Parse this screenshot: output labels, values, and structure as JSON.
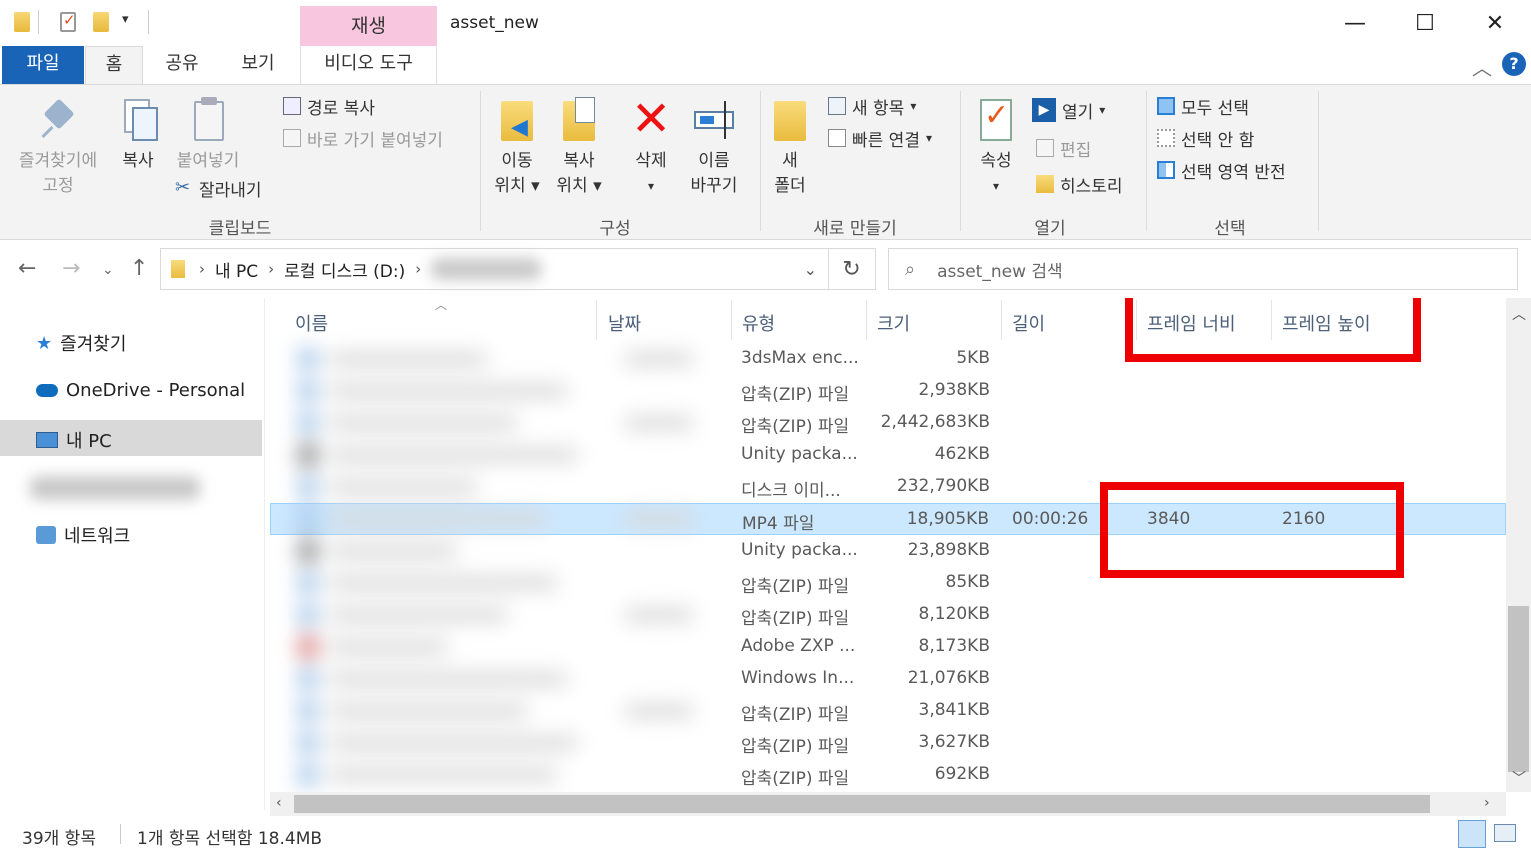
{
  "window": {
    "title": "asset_new",
    "context_tab_group": "재생",
    "controls": {
      "minimize": "—",
      "maximize": "☐",
      "close": "✕"
    }
  },
  "ribbon_tabs": {
    "file": "파일",
    "home": "홈",
    "share": "공유",
    "view": "보기",
    "video_tools": "비디오 도구"
  },
  "ribbon": {
    "clipboard": {
      "label": "클립보드",
      "pin": [
        "즐겨찾기에",
        "고정"
      ],
      "copy": "복사",
      "paste": "붙여넣기",
      "copy_path": "경로 복사",
      "paste_shortcut": "바로 가기 붙여넣기",
      "cut": "잘라내기"
    },
    "organize": {
      "label": "구성",
      "move_to": [
        "이동",
        "위치"
      ],
      "copy_to": [
        "복사",
        "위치"
      ],
      "delete": "삭제",
      "rename": [
        "이름",
        "바꾸기"
      ]
    },
    "new": {
      "label": "새로 만들기",
      "new_folder": [
        "새",
        "폴더"
      ],
      "new_item": "새 항목",
      "easy_access": "빠른 연결"
    },
    "open": {
      "label": "열기",
      "properties": "속성",
      "open": "열기",
      "edit": "편집",
      "history": "히스토리"
    },
    "select": {
      "label": "선택",
      "select_all": "모두 선택",
      "select_none": "선택 안 함",
      "invert": "선택 영역 반전"
    }
  },
  "address": {
    "crumbs": [
      "내 PC",
      "로컬 디스크 (D:)"
    ],
    "search_placeholder": "asset_new 검색"
  },
  "nav_pane": {
    "quick_access": "즐겨찾기",
    "onedrive": "OneDrive - Personal",
    "this_pc": "내 PC",
    "network": "네트워크"
  },
  "columns": {
    "name": "이름",
    "date": "날짜",
    "type": "유형",
    "size": "크기",
    "length": "길이",
    "frame_width": "프레임 너비",
    "frame_height": "프레임 높이"
  },
  "files": [
    {
      "type": "3dsMax enc...",
      "size": "5KB",
      "length": "",
      "width": "",
      "height": ""
    },
    {
      "type": "압축(ZIP) 파일",
      "size": "2,938KB",
      "length": "",
      "width": "",
      "height": ""
    },
    {
      "type": "압축(ZIP) 파일",
      "size": "2,442,683KB",
      "length": "",
      "width": "",
      "height": ""
    },
    {
      "type": "Unity packa...",
      "size": "462KB",
      "length": "",
      "width": "",
      "height": ""
    },
    {
      "type": "디스크 이미...",
      "size": "232,790KB",
      "length": "",
      "width": "",
      "height": ""
    },
    {
      "type": "MP4 파일",
      "size": "18,905KB",
      "length": "00:00:26",
      "width": "3840",
      "height": "2160",
      "selected": true
    },
    {
      "type": "Unity packa...",
      "size": "23,898KB",
      "length": "",
      "width": "",
      "height": ""
    },
    {
      "type": "압축(ZIP) 파일",
      "size": "85KB",
      "length": "",
      "width": "",
      "height": ""
    },
    {
      "type": "압축(ZIP) 파일",
      "size": "8,120KB",
      "length": "",
      "width": "",
      "height": ""
    },
    {
      "type": "Adobe ZXP ...",
      "size": "8,173KB",
      "length": "",
      "width": "",
      "height": ""
    },
    {
      "type": "Windows In...",
      "size": "21,076KB",
      "length": "",
      "width": "",
      "height": ""
    },
    {
      "type": "압축(ZIP) 파일",
      "size": "3,841KB",
      "length": "",
      "width": "",
      "height": ""
    },
    {
      "type": "압축(ZIP) 파일",
      "size": "3,627KB",
      "length": "",
      "width": "",
      "height": ""
    },
    {
      "type": "압축(ZIP) 파일",
      "size": "692KB",
      "length": "",
      "width": "",
      "height": ""
    }
  ],
  "status": {
    "item_count": "39개 항목",
    "selection": "1개 항목 선택함 18.4MB"
  },
  "colors": {
    "accent": "#1a64b8",
    "selection": "#cce8ff",
    "highlight_box": "#ee0000",
    "context_tab": "#f8c7df"
  }
}
